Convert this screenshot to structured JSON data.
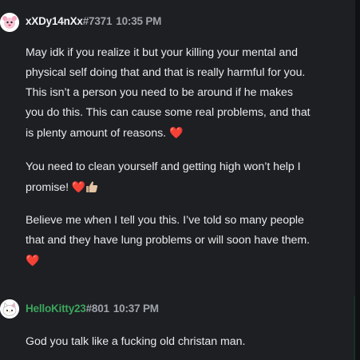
{
  "colors": {
    "background": "#1e1f22",
    "username_green": "#3ba55d",
    "text": "#e8e9eb",
    "muted": "#9ea3aa",
    "heart": "#e0403f"
  },
  "messages": [
    {
      "avatar_icon": "pink-cartoon-avatar-icon",
      "username": "xXDy14nXx",
      "discriminator": "#7371",
      "timestamp": "10:35 PM",
      "paragraphs": [
        {
          "text": "May idk if you realize it but your killing your mental and physical self doing that and that is really harmful for you. This isn’t a person you need to be around if he makes you do this. This can cause some real problems, and that is plenty amount of reasons.",
          "emoji": [
            "❤️"
          ]
        },
        {
          "text": "You need to clean yourself and getting high won’t help I promise!",
          "emoji": [
            "❤️",
            "👍🏼"
          ]
        },
        {
          "text": "Believe me when I tell you this. I’ve told so many people that and they have lung problems or will soon have them.",
          "emoji": [
            "❤️"
          ]
        }
      ]
    },
    {
      "avatar_icon": "hello-kitty-avatar-icon",
      "username": "HelloKitty23",
      "discriminator": "#801",
      "timestamp": "10:37 PM",
      "paragraphs": [
        {
          "text": "God you talk like a fucking old christan man.",
          "emoji": []
        }
      ]
    }
  ]
}
